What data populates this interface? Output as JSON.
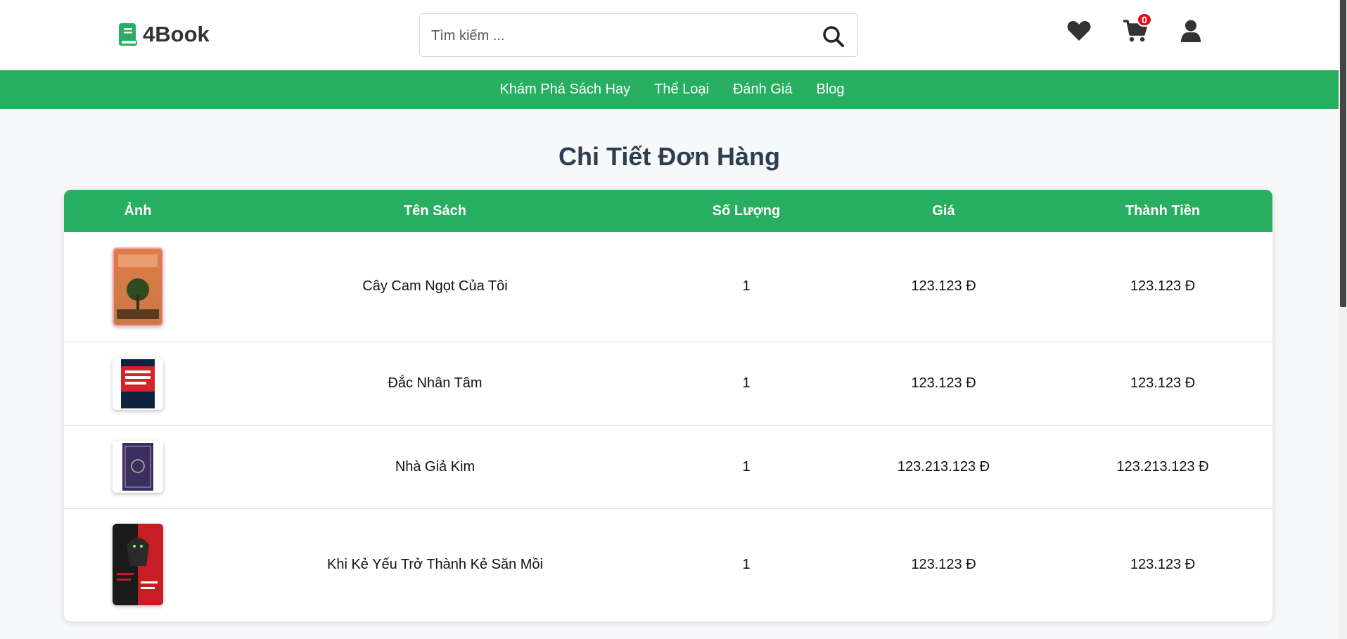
{
  "header": {
    "logo_text": "4Book",
    "search": {
      "placeholder": "Tìm kiếm ...",
      "value": ""
    },
    "cart_count": "0"
  },
  "nav": {
    "items": [
      "Khám Phá Sách Hay",
      "Thể Loại",
      "Đánh Giá",
      "Blog"
    ]
  },
  "main": {
    "title": "Chi Tiết Đơn Hàng",
    "columns": [
      "Ảnh",
      "Tên Sách",
      "Số Lượng",
      "Giá",
      "Thành Tiền"
    ],
    "rows": [
      {
        "name": "Cây Cam Ngọt Của Tôi",
        "qty": "1",
        "price": "123.123 Đ",
        "total": "123.123 Đ",
        "cover_colors": [
          "#e8835a",
          "#3b5f2b"
        ]
      },
      {
        "name": "Đắc Nhân Tâm",
        "qty": "1",
        "price": "123.123 Đ",
        "total": "123.123 Đ",
        "cover_colors": [
          "#d6232a",
          "#0e2340"
        ]
      },
      {
        "name": "Nhà Giả Kim",
        "qty": "1",
        "price": "123.213.123 Đ",
        "total": "123.213.123 Đ",
        "cover_colors": [
          "#3a2f5e",
          "#8a7aa8"
        ]
      },
      {
        "name": "Khi Kẻ Yếu Trở Thành Kẻ Săn Mồi",
        "qty": "1",
        "price": "123.123 Đ",
        "total": "123.123 Đ",
        "cover_colors": [
          "#1a1a1a",
          "#c81d25"
        ]
      }
    ]
  },
  "colors": {
    "accent": "#27ae60",
    "title": "#2c3e50",
    "badge": "#e0111c"
  }
}
